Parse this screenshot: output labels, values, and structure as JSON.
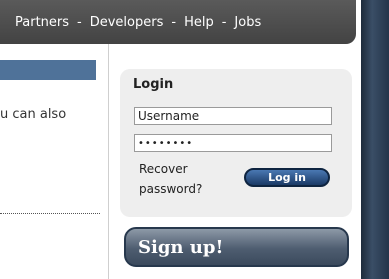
{
  "nav": {
    "items": [
      "Partners",
      "Developers",
      "Help",
      "Jobs"
    ],
    "separator": "-"
  },
  "left": {
    "text": "u can also"
  },
  "login": {
    "title": "Login",
    "username_value": "Username",
    "password_value": "••••••••",
    "recover_line1": "Recover",
    "recover_line2": "password?",
    "login_label": "Log in"
  },
  "signup": {
    "label": "Sign up!"
  },
  "colors": {
    "nav_bg": "#4a4a4a",
    "accent": "#4f7299",
    "panel_bg": "#eeeeee",
    "button_dark": "#1a3a66"
  }
}
